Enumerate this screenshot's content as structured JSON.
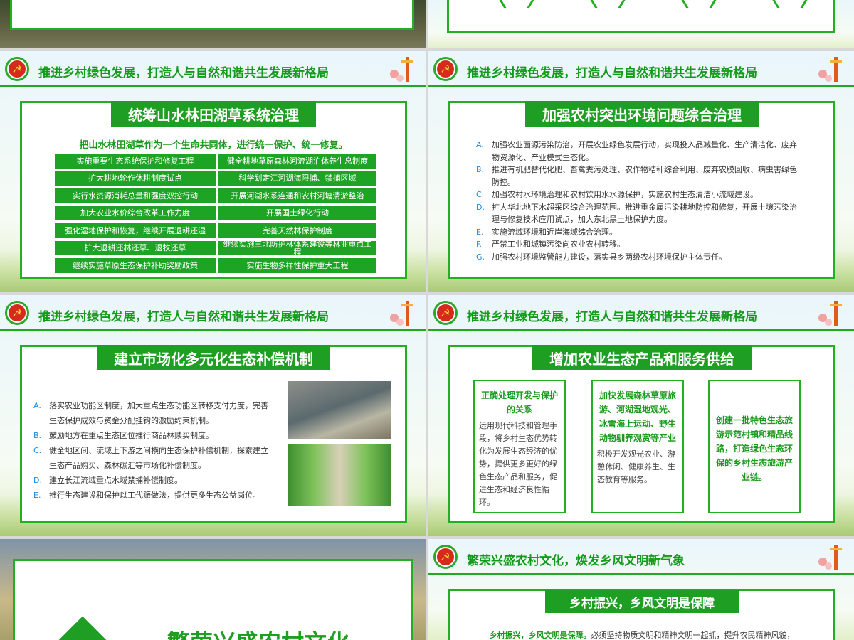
{
  "header_title": "推进乡村绿色发展，打造人与自然和谐共生发展新格局",
  "header_title_last": "繁荣兴盛农村文化，焕发乡风文明新气象",
  "emblem_glyph": "☭",
  "colors": {
    "green": "#1e9e22",
    "accent_blue": "#1c8ae0",
    "red": "#d62a1d"
  },
  "slide_mountain": {
    "title": "统筹山水林田湖草系统治理",
    "subtitle": "把山水林田湖草作为一个生命共同体，进行统一保护、统一修复。",
    "cells": [
      "实施重要生态系统保护和修复工程",
      "健全耕地草原森林河流湖泊休养生息制度",
      "扩大耕地轮作休耕制度试点",
      "科学划定江河湖海限捕、禁捕区域",
      "实行水资源消耗总量和强度双控行动",
      "开展河湖水系连通和农村河塘清淤整治",
      "加大农业水价综合改革工作力度",
      "开展国土绿化行动",
      "强化湿地保护和恢复，继续开展退耕还湿",
      "完善天然林保护制度",
      "扩大退耕还林还草、退牧还草",
      "继续实施三北防护林体系建设等林业重点工程",
      "继续实施草原生态保护补助奖励政策",
      "实施生物多样性保护重大工程"
    ]
  },
  "slide_env": {
    "title": "加强农村突出环境问题综合治理",
    "items": [
      {
        "key": "A.",
        "lines": [
          "加强农业面源污染防治，开展农业绿色发展行动，实现投入品减量化、生产清洁化、废弃",
          "物资源化、产业模式生态化。"
        ]
      },
      {
        "key": "B.",
        "lines": [
          "推进有机肥替代化肥、畜禽粪污处理、农作物秸秆综合利用、废弃农膜回收、病虫害绿色",
          "防控。"
        ]
      },
      {
        "key": "C.",
        "lines": [
          "加强农村水环境治理和农村饮用水水源保护，实施农村生态清洁小流域建设。"
        ]
      },
      {
        "key": "D.",
        "lines": [
          "扩大华北地下水超采区综合治理范围。推进重金属污染耕地防控和修复，开展土壤污染治",
          "理与修复技术应用试点，加大东北黑土地保护力度。"
        ]
      },
      {
        "key": "E.",
        "lines": [
          "实施流域环境和近岸海域综合治理。"
        ]
      },
      {
        "key": "F.",
        "lines": [
          "严禁工业和城镇污染向农业农村转移。"
        ]
      },
      {
        "key": "G.",
        "lines": [
          "加强农村环境监管能力建设，落实县乡两级农村环境保护主体责任。"
        ]
      }
    ]
  },
  "slide_market": {
    "title": "建立市场化多元化生态补偿机制",
    "items": [
      {
        "key": "A.",
        "lines": [
          "落实农业功能区制度，加大重点生态功能区转移支付力度，完善",
          "生态保护成效与资金分配挂钩的激励约束机制。"
        ]
      },
      {
        "key": "B.",
        "lines": [
          "鼓励地方在重点生态区位推行商品林赎买制度。"
        ]
      },
      {
        "key": "C.",
        "lines": [
          "健全地区间、流域上下游之间横向生态保护补偿机制，探索建立",
          "生态产品购买、森林碳汇等市场化补偿制度。"
        ]
      },
      {
        "key": "D.",
        "lines": [
          "建立长江流域重点水域禁捕补偿制度。"
        ]
      },
      {
        "key": "E.",
        "lines": [
          "推行生态建设和保护以工代赈做法，提供更多生态公益岗位。"
        ]
      }
    ]
  },
  "slide_supply": {
    "title": "增加农业生态产品和服务供给",
    "boxes": [
      {
        "title": "正确处理开发与保护的关系",
        "body": "运用现代科技和管理手段，将乡村生态优势转化为发展生态经济的优势，提供更多更好的绿色生态产品和服务，促进生态和经济良性循环。"
      },
      {
        "title": "加快发展森林草原旅游、河湖湿地观光、冰雪海上运动、野生动物驯养观赏等产业",
        "body": "积极开发观光农业、游憩休闲、健康养生、生态教育等服务。"
      },
      {
        "title": "创建一批特色生态旅游示范村镇和精品线路，打造绿色生态环保的乡村生态旅游产业链。",
        "body": ""
      }
    ]
  },
  "slide_cover": {
    "title": "繁荣兴盛农村文化"
  },
  "slide_culture": {
    "title": "乡村振兴，乡风文明是保障",
    "lead": "乡村振兴，乡风文明是保障。",
    "rest": "必须坚持物质文明和精神文明一起抓，提升农民精神风貌，"
  }
}
